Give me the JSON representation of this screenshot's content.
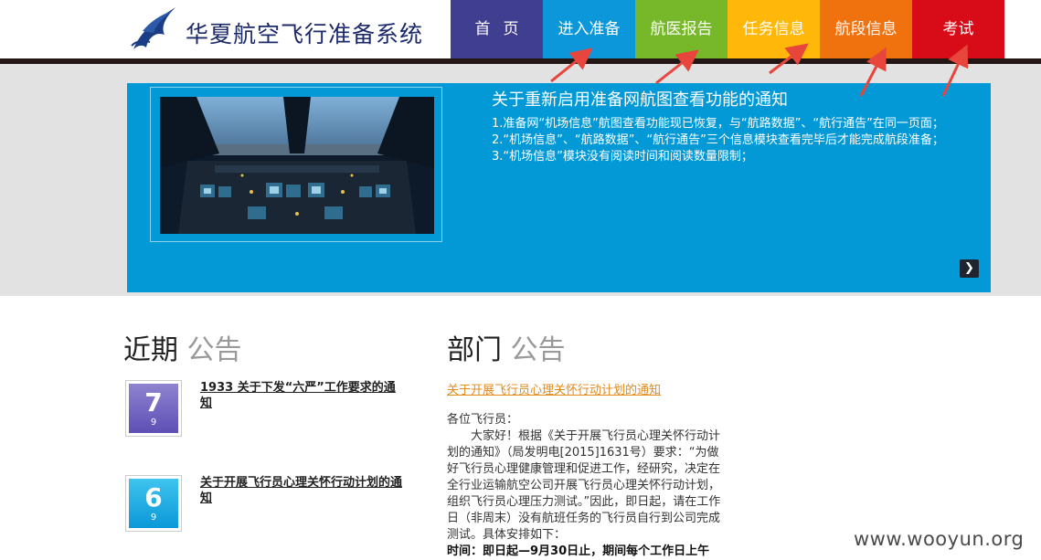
{
  "header": {
    "site_title": "华夏航空飞行准备系统",
    "logo_icon": "bird-wing-logo-icon"
  },
  "nav": {
    "items": [
      {
        "label": "首页",
        "color": "#3f3e90"
      },
      {
        "label": "进入准备",
        "color": "#0c97da"
      },
      {
        "label": "航医报告",
        "color": "#77b82a"
      },
      {
        "label": "任务信息",
        "color": "#ffb80a"
      },
      {
        "label": "航段信息",
        "color": "#f0720f"
      },
      {
        "label": "考试",
        "color": "#d70c18"
      }
    ]
  },
  "banner": {
    "title": "关于重新启用准备网航图查看功能的通知",
    "lines": [
      "1.准备网“机场信息”航图查看功能现已恢复，与“航路数据”、“航行通告”在同一页面；",
      "2.“机场信息”、“航路数据”、“航行通告”三个信息模块查看完毕后才能完成航段准备；",
      "3.“机场信息”模块没有阅读时间和阅读数量限制；"
    ],
    "next_icon": "chevron-right-icon",
    "image": "cockpit-photo"
  },
  "recent": {
    "heading_dark": "近期",
    "heading_light": "公告",
    "items": [
      {
        "day": "7",
        "month": "9",
        "title": "1933 关于下发“六严”工作要求的通知"
      },
      {
        "day": "6",
        "month": "9",
        "title": "关于开展飞行员心理关怀行动计划的通知"
      }
    ]
  },
  "dept": {
    "heading_dark": "部门",
    "heading_light": "公告",
    "link": "关于开展飞行员心理关怀行动计划的通知",
    "greeting": "各位飞行员：",
    "body": "大家好！根据《关于开展飞行员心理关怀行动计划的通知》（局发明电[2015]1631号）要求：“为做好飞行员心理健康管理和促进工作，经研究，决定在全行业运输航空公司开展飞行员心理关怀行动计划，组织飞行员心理压力测试。”因此，即日起，请在工作日（非周末）没有航班任务的飞行员自行到公司完成测试。具体安排如下：",
    "schedule": "时间：即日起—9月30日止，期间每个工作日上午"
  },
  "watermark": "www.wooyun.org",
  "colors": {
    "banner_bg": "#0399d6",
    "annotation_arrow": "#e8453c",
    "dept_link": "#e08a1c"
  }
}
